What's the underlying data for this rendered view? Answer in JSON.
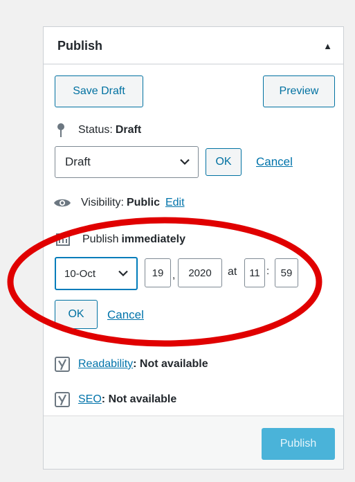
{
  "panel": {
    "title": "Publish",
    "toggle_icon": "triangle-up-icon"
  },
  "actions": {
    "save_draft_label": "Save Draft",
    "preview_label": "Preview"
  },
  "status": {
    "label": "Status:",
    "value": "Draft",
    "select_value": "Draft",
    "ok_label": "OK",
    "cancel_label": "Cancel"
  },
  "visibility": {
    "label": "Visibility:",
    "value": "Public",
    "edit_label": "Edit"
  },
  "schedule": {
    "label": "Publish",
    "value": "immediately",
    "month_value": "10-Oct",
    "day_value": "19",
    "day_sep": ",",
    "year_value": "2020",
    "at_label": "at",
    "hour_value": "11",
    "time_sep": ":",
    "minute_value": "59",
    "ok_label": "OK",
    "cancel_label": "Cancel"
  },
  "seo": {
    "readability_link": "Readability",
    "readability_value": ": Not available",
    "seo_link": "SEO",
    "seo_value": ": Not available"
  },
  "footer": {
    "publish_label": "Publish"
  },
  "annotation": {
    "color": "#e00000"
  }
}
